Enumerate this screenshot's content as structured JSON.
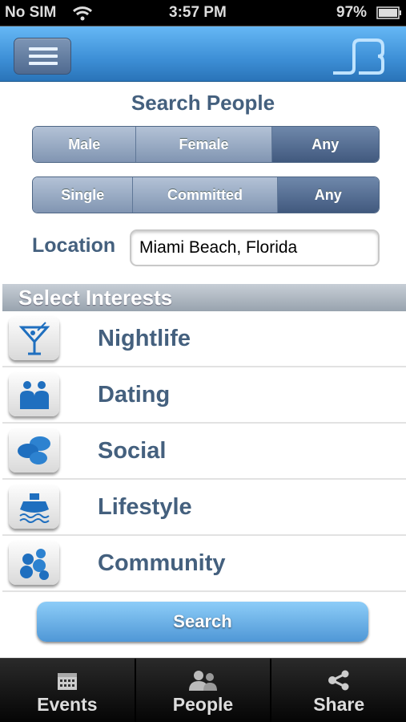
{
  "status_bar": {
    "carrier": "No SIM",
    "time": "3:57 PM",
    "battery": "97%",
    "battery_level": 0.97
  },
  "header": {
    "menu_icon": "hamburger-icon",
    "logo_icon": "app-logo"
  },
  "page_title": "Search People",
  "gender_filter": {
    "options": [
      "Male",
      "Female",
      "Any"
    ],
    "selected": "Any"
  },
  "relationship_filter": {
    "options": [
      "Single",
      "Committed",
      "Any"
    ],
    "selected": "Any"
  },
  "location": {
    "label": "Location",
    "value": "Miami Beach, Florida"
  },
  "interests": {
    "title": "Select Interests",
    "items": [
      {
        "label": "Nightlife",
        "icon": "cocktail-icon"
      },
      {
        "label": "Dating",
        "icon": "couple-icon"
      },
      {
        "label": "Social",
        "icon": "chat-bubbles-icon"
      },
      {
        "label": "Lifestyle",
        "icon": "cruise-ship-icon"
      },
      {
        "label": "Community",
        "icon": "group-icon"
      }
    ]
  },
  "search_button": "Search",
  "tab_bar": [
    {
      "label": "Events",
      "icon": "calendar-icon"
    },
    {
      "label": "People",
      "icon": "people-icon"
    },
    {
      "label": "Share",
      "icon": "share-icon"
    }
  ],
  "colors": {
    "accent": "#4f97d6",
    "text": "#44607e",
    "selected_segment": "#41597e"
  }
}
